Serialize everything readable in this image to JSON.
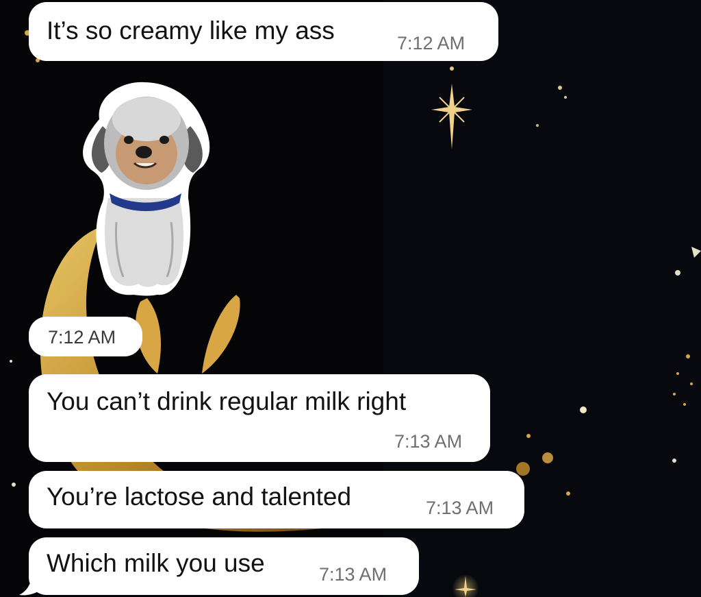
{
  "chat": {
    "messages": [
      {
        "text": "It’s so creamy like my ass",
        "time": "7:12 AM"
      },
      {
        "sticker": "dog-sticker",
        "time": "7:12 AM"
      },
      {
        "text": "You can’t drink regular milk right",
        "time": "7:13 AM"
      },
      {
        "text": "You’re lactose and talented",
        "time": "7:13 AM"
      },
      {
        "text": "Which milk you use",
        "time": "7:13 AM"
      }
    ]
  },
  "theme": {
    "wallpaper": "#050507",
    "bubble": "#ffffff",
    "text": "#121212",
    "time": "#6e6e73",
    "accent_gold": "#d9a645"
  }
}
